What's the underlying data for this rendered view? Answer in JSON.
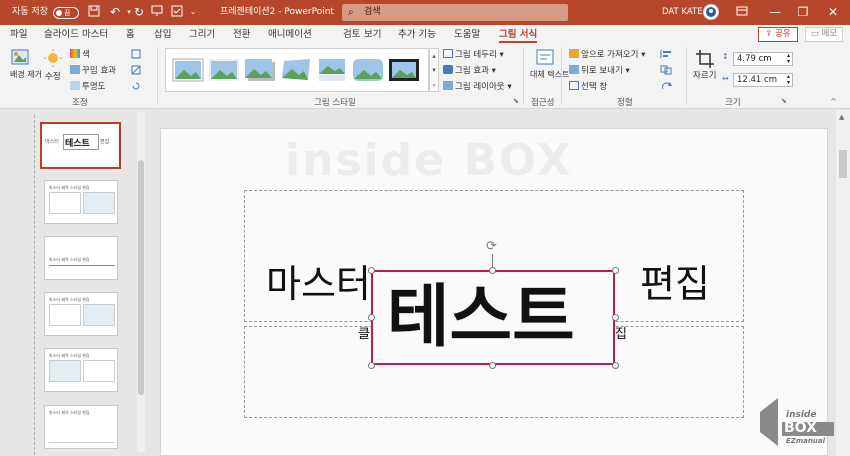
{
  "titlebar": {
    "autosave_label": "자동 저장",
    "autosave_state": "끔",
    "doc_title": "프레젠테이션2 - PowerPoint",
    "search_placeholder": "검색",
    "user_name": "DAT KATE",
    "win_min": "—",
    "win_max": "❐",
    "win_close": "✕",
    "quick_icons": [
      "save-icon",
      "undo-icon",
      "redo-icon",
      "present-icon",
      "customize-icon"
    ]
  },
  "tabs": [
    "파일",
    "슬라이드 마스터",
    "홈",
    "삽입",
    "그리기",
    "전환",
    "애니메이션",
    "검토",
    "보기",
    "추가 기능",
    "도움말",
    "그림 서식"
  ],
  "active_tab": "그림 서식",
  "share_label": "공유",
  "memo_label": "메모",
  "ribbon": {
    "adjust": {
      "remove_bg_label": "배경 제거",
      "corrections_label": "수정",
      "color_label": "색",
      "artistic_label": "꾸밈 효과",
      "transparency_label": "투명도",
      "group_label": "조정"
    },
    "styles": {
      "group_label": "그림 스타일",
      "border_label": "그림 테두리",
      "effects_label": "그림 효과",
      "layout_label": "그림 레이아웃"
    },
    "accessibility": {
      "alt_text_label": "대체 텍스트",
      "group_label": "접근성"
    },
    "arrange": {
      "forward_label": "앞으로 가져오기",
      "backward_label": "뒤로 보내기",
      "selection_label": "선택 창",
      "group_label": "정렬"
    },
    "size": {
      "crop_label": "자르기",
      "height": "4.79 cm",
      "width": "12.41 cm",
      "group_label": "크기"
    }
  },
  "thumbnails": [
    {
      "title": "마스터",
      "big": "테스트",
      "right": "편집",
      "selected": true
    },
    {
      "title": "마스터 제목 스타일 편집",
      "selected": false
    },
    {
      "title": "마스터 제목 스타일 편집",
      "selected": false
    },
    {
      "title": "마스터 제목 스타일 편집",
      "selected": false
    },
    {
      "title": "마스터 제목 스타일 편집",
      "selected": false
    },
    {
      "title": "마스터 제목 스타일 편집",
      "selected": false
    }
  ],
  "slide": {
    "watermark": "inside BOX",
    "title_left": "마스터",
    "title_right": "편집",
    "subtitle_left": "클",
    "subtitle_right": "집",
    "textbox_text": "테스트"
  },
  "logo": {
    "line1": "inside",
    "line2": "BOX",
    "line3": "EZmanual"
  },
  "colors": {
    "accent": "#b7472a",
    "selection": "#c2185b",
    "thumb_selected": "#c0392b"
  }
}
